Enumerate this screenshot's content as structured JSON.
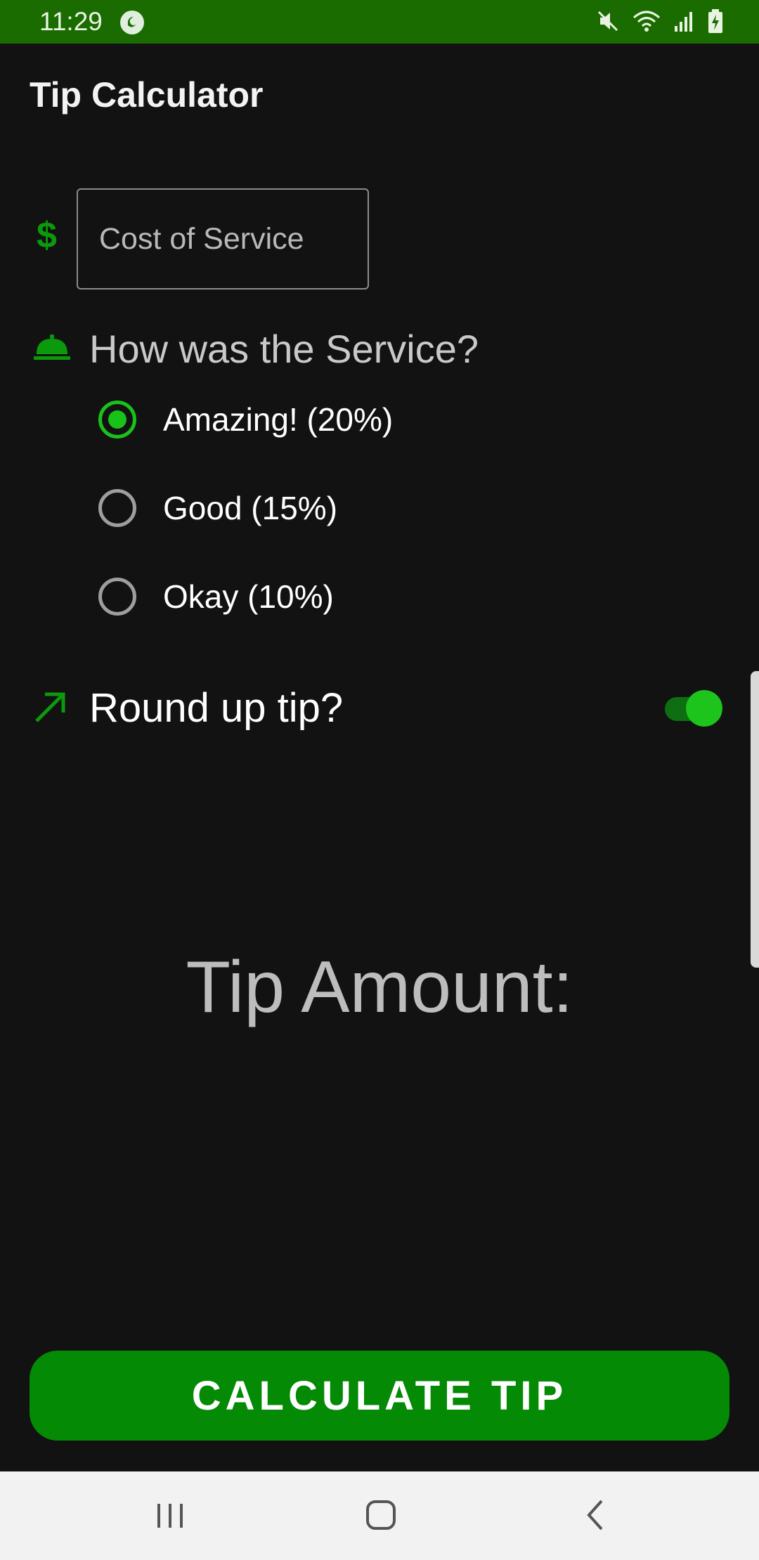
{
  "status_bar": {
    "time": "11:29",
    "icons": [
      "app-notification-icon",
      "mute-icon",
      "wifi-icon",
      "signal-icon",
      "battery-charging-icon"
    ]
  },
  "app": {
    "title": "Tip Calculator"
  },
  "cost_input": {
    "placeholder": "Cost of Service",
    "value": "",
    "icon": "dollar-icon",
    "icon_text": "$"
  },
  "service": {
    "question": "How was the Service?",
    "icon": "room-service-bell-icon",
    "options": [
      {
        "label": "Amazing! (20%)",
        "checked": true
      },
      {
        "label": "Good (15%)",
        "checked": false
      },
      {
        "label": "Okay (10%)",
        "checked": false
      }
    ]
  },
  "round_up": {
    "label": "Round up tip?",
    "icon": "trending-up-arrow-icon",
    "enabled": true
  },
  "result": {
    "label": "Tip Amount:"
  },
  "calculate_button": {
    "label": "CALCULATE TIP"
  },
  "colors": {
    "status_bar": "#1b6c00",
    "accent": "#19c219",
    "button": "#048a04",
    "background": "#121212"
  },
  "nav_bar": {
    "buttons": [
      "recent-apps-icon",
      "home-icon",
      "back-icon"
    ]
  }
}
